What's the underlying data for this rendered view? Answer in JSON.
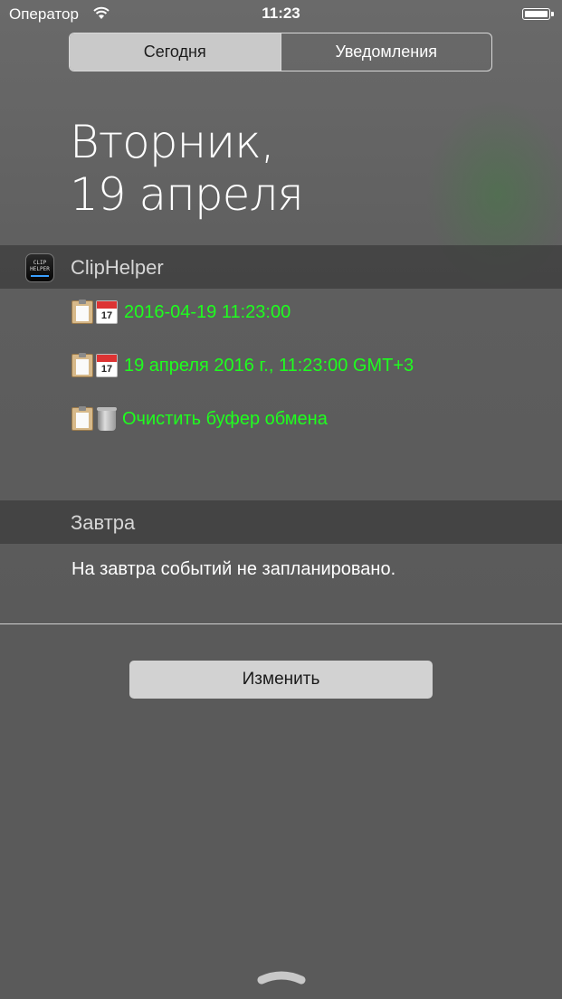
{
  "status_bar": {
    "carrier": "Оператор",
    "time": "11:23"
  },
  "tabs": {
    "today": "Сегодня",
    "notifications": "Уведомления",
    "selected": "Сегодня"
  },
  "date_heading": {
    "line1": "Вторник,",
    "line2": "19 апреля"
  },
  "widget": {
    "app_name": "ClipHelper",
    "icon_text_1": "CLIP",
    "icon_text_2": "HELPER",
    "actions": [
      {
        "icon": "calendar-icon",
        "label": "2016-04-19 11:23:00"
      },
      {
        "icon": "calendar-icon",
        "label": "19 апреля 2016 г., 11:23:00 GMT+3"
      },
      {
        "icon": "trash-icon",
        "label": "Очистить буфер обмена"
      }
    ],
    "calendar_day": "17",
    "text_color": "#1eff1e"
  },
  "tomorrow": {
    "header": "Завтра",
    "message": "На завтра событий не запланировано."
  },
  "edit_button": "Изменить"
}
